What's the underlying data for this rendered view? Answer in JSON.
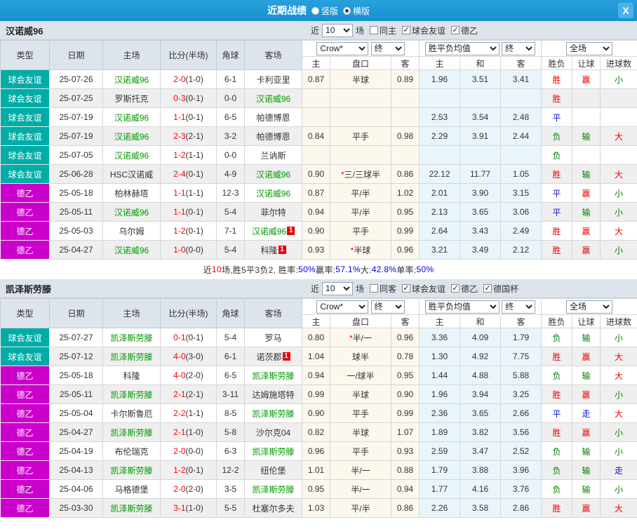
{
  "titlebar": {
    "title": "近期战绩",
    "radios": [
      {
        "label": "竖版",
        "checked": false
      },
      {
        "label": "横版",
        "checked": true
      }
    ],
    "close_icon": "X"
  },
  "table_headers": {
    "main": [
      "类型",
      "日期",
      "主场",
      "比分(半场)",
      "角球",
      "客场"
    ],
    "dropdowns": [
      "Crow*",
      "终",
      "胜平负均值",
      "终",
      "全场"
    ],
    "sub": [
      "主",
      "盘口",
      "客",
      "主",
      "和",
      "客",
      "胜负",
      "让球",
      "进球数"
    ]
  },
  "type_colors": {
    "球会友谊": "#00ada6",
    "德乙": "#cc00cc"
  },
  "result_colors": {
    "胜": "#ee0000",
    "平": "#1414d2",
    "负": "#008000",
    "赢": "#ee0000",
    "输": "#008000",
    "走": "#1414d2",
    "大": "#ee0000",
    "小": "#008000"
  },
  "sections": [
    {
      "team": "汉诺威96",
      "filters": {
        "near": "近",
        "count": "10",
        "games": "场",
        "same": {
          "label": "同主",
          "checked": false
        },
        "comps": [
          {
            "label": "球会友谊",
            "checked": true
          },
          {
            "label": "德乙",
            "checked": true
          }
        ]
      },
      "rows": [
        {
          "type": "球会友谊",
          "date": "25-07-26",
          "home": "汉诺威96",
          "hg": true,
          "hb": "",
          "score": "2-0",
          "half": "(1-0)",
          "corner": "6-1",
          "away": "卡利亚里",
          "ag": false,
          "ab": "",
          "o1": "0.87",
          "hc": "半球",
          "star": false,
          "o2": "0.89",
          "m1": "1.96",
          "m2": "3.51",
          "m3": "3.41",
          "r1": "胜",
          "r2": "赢",
          "r3": "小"
        },
        {
          "type": "球会友谊",
          "date": "25-07-25",
          "home": "罗斯托克",
          "hg": false,
          "hb": "",
          "score": "0-3",
          "half": "(0-1)",
          "corner": "0-0",
          "away": "汉诺威96",
          "ag": true,
          "ab": "",
          "o1": "",
          "hc": "",
          "star": false,
          "o2": "",
          "m1": "",
          "m2": "",
          "m3": "",
          "r1": "胜",
          "r2": "",
          "r3": ""
        },
        {
          "type": "球会友谊",
          "date": "25-07-19",
          "home": "汉诺威96",
          "hg": true,
          "hb": "",
          "score": "1-1",
          "half": "(0-1)",
          "corner": "6-5",
          "away": "帕德博恩",
          "ag": false,
          "ab": "",
          "o1": "",
          "hc": "",
          "star": false,
          "o2": "",
          "m1": "2.53",
          "m2": "3.54",
          "m3": "2.48",
          "r1": "平",
          "r2": "",
          "r3": ""
        },
        {
          "type": "球会友谊",
          "date": "25-07-19",
          "home": "汉诺威96",
          "hg": true,
          "hb": "",
          "score": "2-3",
          "half": "(2-1)",
          "corner": "3-2",
          "away": "帕德博恩",
          "ag": false,
          "ab": "",
          "o1": "0.84",
          "hc": "平手",
          "star": false,
          "o2": "0.98",
          "m1": "2.29",
          "m2": "3.91",
          "m3": "2.44",
          "r1": "负",
          "r2": "输",
          "r3": "大"
        },
        {
          "type": "球会友谊",
          "date": "25-07-05",
          "home": "汉诺威96",
          "hg": true,
          "hb": "",
          "score": "1-2",
          "half": "(1-1)",
          "corner": "0-0",
          "away": "兰讷斯",
          "ag": false,
          "ab": "",
          "o1": "",
          "hc": "",
          "star": false,
          "o2": "",
          "m1": "",
          "m2": "",
          "m3": "",
          "r1": "负",
          "r2": "",
          "r3": ""
        },
        {
          "type": "球会友谊",
          "date": "25-06-28",
          "home": "HSC汉诺威",
          "hg": false,
          "hb": "",
          "score": "2-4",
          "half": "(0-1)",
          "corner": "4-9",
          "away": "汉诺威96",
          "ag": true,
          "ab": "",
          "o1": "0.90",
          "hc": "三/三球半",
          "star": true,
          "o2": "0.86",
          "m1": "22.12",
          "m2": "11.77",
          "m3": "1.05",
          "r1": "胜",
          "r2": "输",
          "r3": "大"
        },
        {
          "type": "德乙",
          "date": "25-05-18",
          "home": "柏林赫塔",
          "hg": false,
          "hb": "",
          "score": "1-1",
          "half": "(1-1)",
          "corner": "12-3",
          "away": "汉诺威96",
          "ag": true,
          "ab": "",
          "o1": "0.87",
          "hc": "平/半",
          "star": false,
          "o2": "1.02",
          "m1": "2.01",
          "m2": "3.90",
          "m3": "3.15",
          "r1": "平",
          "r2": "赢",
          "r3": "小"
        },
        {
          "type": "德乙",
          "date": "25-05-11",
          "home": "汉诺威96",
          "hg": true,
          "hb": "",
          "score": "1-1",
          "half": "(0-1)",
          "corner": "5-4",
          "away": "菲尔特",
          "ag": false,
          "ab": "",
          "o1": "0.94",
          "hc": "平/半",
          "star": false,
          "o2": "0.95",
          "m1": "2.13",
          "m2": "3.65",
          "m3": "3.06",
          "r1": "平",
          "r2": "输",
          "r3": "小"
        },
        {
          "type": "德乙",
          "date": "25-05-03",
          "home": "乌尔姆",
          "hg": false,
          "hb": "",
          "score": "1-2",
          "half": "(0-1)",
          "corner": "7-1",
          "away": "汉诺威96",
          "ag": true,
          "ab": "1",
          "o1": "0.90",
          "hc": "平手",
          "star": false,
          "o2": "0.99",
          "m1": "2.64",
          "m2": "3.43",
          "m3": "2.49",
          "r1": "胜",
          "r2": "赢",
          "r3": "大"
        },
        {
          "type": "德乙",
          "date": "25-04-27",
          "home": "汉诺威96",
          "hg": true,
          "hb": "",
          "score": "1-0",
          "half": "(0-0)",
          "corner": "5-4",
          "away": "科隆",
          "ag": false,
          "ab": "1",
          "o1": "0.93",
          "hc": "半球",
          "star": true,
          "o2": "0.96",
          "m1": "3.21",
          "m2": "3.49",
          "m3": "2.12",
          "r1": "胜",
          "r2": "赢",
          "r3": "小"
        }
      ],
      "summary": [
        {
          "t": "近",
          "c": "#333333"
        },
        {
          "t": "10",
          "c": "#ee0000"
        },
        {
          "t": "场,胜5平3负2, 胜率:",
          "c": "#333333"
        },
        {
          "t": "50%",
          "c": "#0000ee"
        },
        {
          "t": " 赢率:",
          "c": "#333333"
        },
        {
          "t": "57.1%",
          "c": "#0000ee"
        },
        {
          "t": " 大:",
          "c": "#333333"
        },
        {
          "t": "42.8%",
          "c": "#0000ee"
        },
        {
          "t": " 单率:",
          "c": "#333333"
        },
        {
          "t": "50%",
          "c": "#0000ee"
        }
      ]
    },
    {
      "team": "凯泽斯劳滕",
      "filters": {
        "near": "近",
        "count": "10",
        "games": "场",
        "same": {
          "label": "同客",
          "checked": false
        },
        "comps": [
          {
            "label": "球会友谊",
            "checked": true
          },
          {
            "label": "德乙",
            "checked": true
          },
          {
            "label": "德国杯",
            "checked": true
          }
        ]
      },
      "rows": [
        {
          "type": "球会友谊",
          "date": "25-07-27",
          "home": "凯泽斯劳滕",
          "hg": true,
          "hb": "",
          "score": "0-1",
          "half": "(0-1)",
          "corner": "5-4",
          "away": "罗马",
          "ag": false,
          "ab": "",
          "o1": "0.80",
          "hc": "半/一",
          "star": true,
          "o2": "0.96",
          "m1": "3.36",
          "m2": "4.09",
          "m3": "1.79",
          "r1": "负",
          "r2": "输",
          "r3": "小"
        },
        {
          "type": "球会友谊",
          "date": "25-07-12",
          "home": "凯泽斯劳滕",
          "hg": true,
          "hb": "",
          "score": "4-0",
          "half": "(3-0)",
          "corner": "6-1",
          "away": "诺茨郡",
          "ag": false,
          "ab": "1",
          "o1": "1.04",
          "hc": "球半",
          "star": false,
          "o2": "0.78",
          "m1": "1.30",
          "m2": "4.92",
          "m3": "7.75",
          "r1": "胜",
          "r2": "赢",
          "r3": "大"
        },
        {
          "type": "德乙",
          "date": "25-05-18",
          "home": "科隆",
          "hg": false,
          "hb": "",
          "score": "4-0",
          "half": "(2-0)",
          "corner": "6-5",
          "away": "凯泽斯劳滕",
          "ag": true,
          "ab": "",
          "o1": "0.94",
          "hc": "一/球半",
          "star": false,
          "o2": "0.95",
          "m1": "1.44",
          "m2": "4.88",
          "m3": "5.88",
          "r1": "负",
          "r2": "输",
          "r3": "大"
        },
        {
          "type": "德乙",
          "date": "25-05-11",
          "home": "凯泽斯劳滕",
          "hg": true,
          "hb": "",
          "score": "2-1",
          "half": "(2-1)",
          "corner": "3-11",
          "away": "达姆施塔特",
          "ag": false,
          "ab": "",
          "o1": "0.99",
          "hc": "半球",
          "star": false,
          "o2": "0.90",
          "m1": "1.96",
          "m2": "3.94",
          "m3": "3.25",
          "r1": "胜",
          "r2": "赢",
          "r3": "小"
        },
        {
          "type": "德乙",
          "date": "25-05-04",
          "home": "卡尔斯鲁厄",
          "hg": false,
          "hb": "",
          "score": "2-2",
          "half": "(1-1)",
          "corner": "8-5",
          "away": "凯泽斯劳滕",
          "ag": true,
          "ab": "",
          "o1": "0.90",
          "hc": "平手",
          "star": false,
          "o2": "0.99",
          "m1": "2.36",
          "m2": "3.65",
          "m3": "2.66",
          "r1": "平",
          "r2": "走",
          "r3": "大"
        },
        {
          "type": "德乙",
          "date": "25-04-27",
          "home": "凯泽斯劳滕",
          "hg": true,
          "hb": "",
          "score": "2-1",
          "half": "(1-0)",
          "corner": "5-8",
          "away": "沙尔克04",
          "ag": false,
          "ab": "",
          "o1": "0.82",
          "hc": "半球",
          "star": false,
          "o2": "1.07",
          "m1": "1.89",
          "m2": "3.82",
          "m3": "3.56",
          "r1": "胜",
          "r2": "赢",
          "r3": "小"
        },
        {
          "type": "德乙",
          "date": "25-04-19",
          "home": "布伦瑞克",
          "hg": false,
          "hb": "",
          "score": "2-0",
          "half": "(0-0)",
          "corner": "6-3",
          "away": "凯泽斯劳滕",
          "ag": true,
          "ab": "",
          "o1": "0.96",
          "hc": "平手",
          "star": false,
          "o2": "0.93",
          "m1": "2.59",
          "m2": "3.47",
          "m3": "2.52",
          "r1": "负",
          "r2": "输",
          "r3": "小"
        },
        {
          "type": "德乙",
          "date": "25-04-13",
          "home": "凯泽斯劳滕",
          "hg": true,
          "hb": "",
          "score": "1-2",
          "half": "(0-1)",
          "corner": "12-2",
          "away": "纽伦堡",
          "ag": false,
          "ab": "",
          "o1": "1.01",
          "hc": "半/一",
          "star": false,
          "o2": "0.88",
          "m1": "1.79",
          "m2": "3.88",
          "m3": "3.96",
          "r1": "负",
          "r2": "输",
          "r3": "走"
        },
        {
          "type": "德乙",
          "date": "25-04-06",
          "home": "马格德堡",
          "hg": false,
          "hb": "",
          "score": "2-0",
          "half": "(2-0)",
          "corner": "3-5",
          "away": "凯泽斯劳滕",
          "ag": true,
          "ab": "",
          "o1": "0.95",
          "hc": "半/一",
          "star": false,
          "o2": "0.94",
          "m1": "1.77",
          "m2": "4.16",
          "m3": "3.76",
          "r1": "负",
          "r2": "输",
          "r3": "小"
        },
        {
          "type": "德乙",
          "date": "25-03-30",
          "home": "凯泽斯劳滕",
          "hg": true,
          "hb": "",
          "score": "3-1",
          "half": "(1-0)",
          "corner": "5-5",
          "away": "杜塞尔多夫",
          "ag": false,
          "ab": "",
          "o1": "1.03",
          "hc": "平/半",
          "star": false,
          "o2": "0.86",
          "m1": "2.26",
          "m2": "3.58",
          "m3": "2.86",
          "r1": "胜",
          "r2": "赢",
          "r3": "大"
        }
      ],
      "summary": null
    }
  ]
}
